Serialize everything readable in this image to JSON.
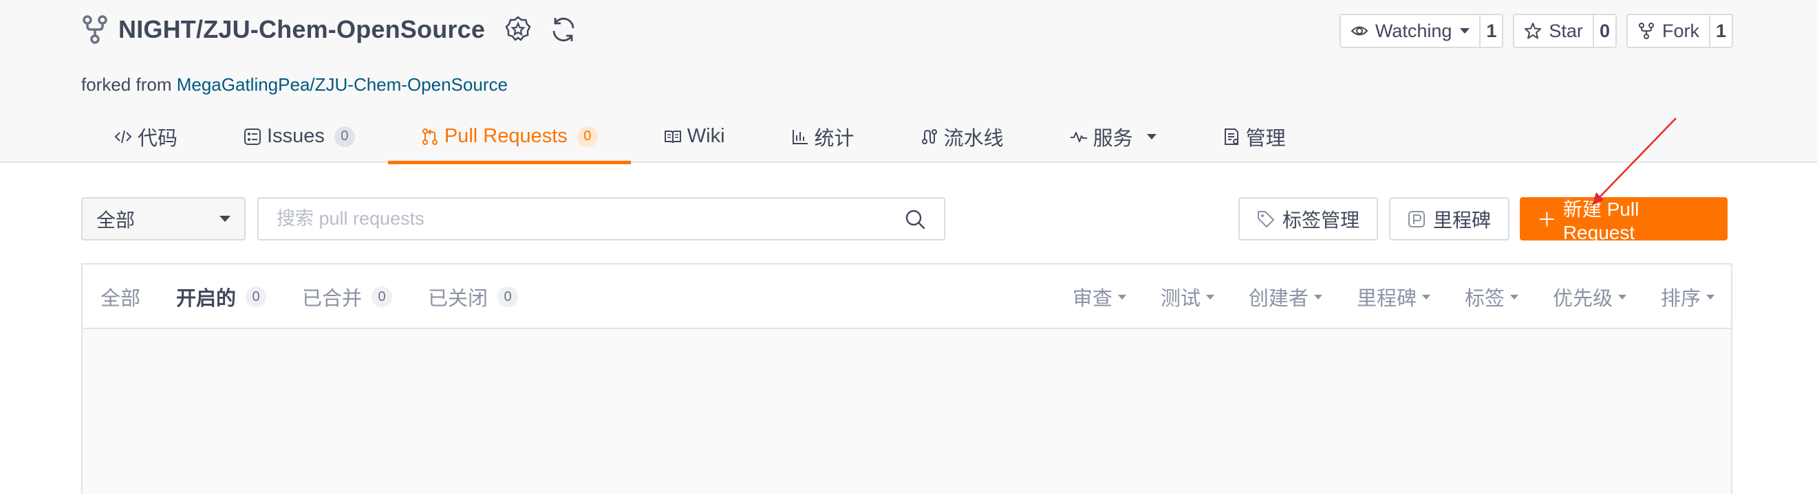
{
  "repo": {
    "full_name": "NIGHT/ZJU-Chem-OpenSource",
    "forked_prefix": "forked from ",
    "forked_source": "MegaGatlingPea/ZJU-Chem-OpenSource"
  },
  "actions": {
    "watch_label": "Watching",
    "watch_count": "1",
    "star_label": "Star",
    "star_count": "0",
    "fork_label": "Fork",
    "fork_count": "1"
  },
  "tabs": [
    {
      "label": "代码",
      "icon": "code-icon"
    },
    {
      "label": "Issues",
      "icon": "issues-icon",
      "badge": "0"
    },
    {
      "label": "Pull Requests",
      "icon": "pull-request-icon",
      "badge": "0",
      "active": true
    },
    {
      "label": "Wiki",
      "icon": "wiki-icon"
    },
    {
      "label": "统计",
      "icon": "stats-icon"
    },
    {
      "label": "流水线",
      "icon": "pipeline-icon"
    },
    {
      "label": "服务",
      "icon": "activity-icon"
    },
    {
      "label": "管理",
      "icon": "manage-icon"
    }
  ],
  "filterbar": {
    "scope_selected": "全部",
    "search_placeholder": "搜索 pull requests",
    "labels_button": "标签管理",
    "milestone_button": "里程碑",
    "new_pr_button": "新建 Pull Request"
  },
  "list": {
    "states": [
      {
        "label": "全部"
      },
      {
        "label": "开启的",
        "count": "0",
        "active": true
      },
      {
        "label": "已合并",
        "count": "0"
      },
      {
        "label": "已关闭",
        "count": "0"
      }
    ],
    "filters": [
      "审查",
      "测试",
      "创建者",
      "里程碑",
      "标签",
      "优先级",
      "排序"
    ]
  },
  "colors": {
    "accent": "#fe7300",
    "link": "#005980",
    "text": "#40485b",
    "annotation_arrow": "#e8282b"
  }
}
